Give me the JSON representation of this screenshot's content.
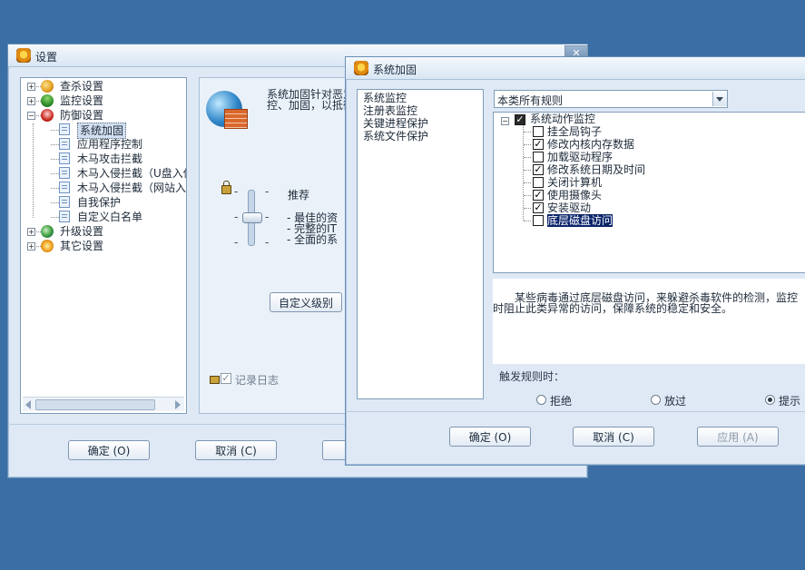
{
  "settings_window": {
    "title": "设置",
    "close_glyph": "✕",
    "tree": [
      {
        "label": "查杀设置",
        "expander": "+",
        "icon": "scan-icon"
      },
      {
        "label": "监控设置",
        "expander": "+",
        "icon": "umbrella-icon"
      },
      {
        "label": "防御设置",
        "expander": "−",
        "icon": "shield-icon"
      },
      {
        "label": "系统加固",
        "icon": "doc-icon",
        "selected": true
      },
      {
        "label": "应用程序控制",
        "icon": "doc-icon"
      },
      {
        "label": "木马攻击拦截",
        "icon": "doc-icon"
      },
      {
        "label": "木马入侵拦截（U盘入侵",
        "icon": "doc-icon"
      },
      {
        "label": "木马入侵拦截（网站入侵",
        "icon": "doc-icon"
      },
      {
        "label": "自我保护",
        "icon": "doc-icon"
      },
      {
        "label": "自定义白名单",
        "icon": "doc-icon"
      },
      {
        "label": "升级设置",
        "expander": "+",
        "icon": "globe-icon"
      },
      {
        "label": "其它设置",
        "expander": "+",
        "icon": "gear-icon"
      }
    ],
    "description": [
      "系统加固针对恶意",
      "控、加固，以抵御"
    ],
    "level_label": "推荐",
    "level_bullets": [
      "- 最佳的资",
      "- 完整的IT",
      "- 全面的系"
    ],
    "level_fraction": 0.5,
    "custom_level_button": "自定义级别",
    "log_checkbox": {
      "label": "记录日志",
      "checked": true
    },
    "ok_button": "确定 (O)",
    "cancel_button": "取消 (C)"
  },
  "harden_window": {
    "title": "系统加固",
    "categories": [
      "系统监控",
      "注册表监控",
      "关键进程保护",
      "系统文件保护"
    ],
    "rule_filter": "本类所有规则",
    "rule_root": {
      "label": "系统动作监控",
      "expander": "−",
      "checked": true
    },
    "rules": [
      {
        "label": "挂全局钩子",
        "checked": false
      },
      {
        "label": "修改内核内存数据",
        "checked": true
      },
      {
        "label": "加载驱动程序",
        "checked": false
      },
      {
        "label": "修改系统日期及时间",
        "checked": true
      },
      {
        "label": "关闭计算机",
        "checked": false
      },
      {
        "label": "使用摄像头",
        "checked": true
      },
      {
        "label": "安装驱动",
        "checked": true
      },
      {
        "label": "底层磁盘访问",
        "checked": false,
        "selected": true
      }
    ],
    "description": [
      "　　某些病毒通过底层磁盘访问，来躲避杀毒软件的检测，监控",
      "时阻止此类异常的访问，保障系统的稳定和安全。"
    ],
    "trigger_label": "触发规则时：",
    "actions": [
      {
        "label": "拒绝",
        "selected": false
      },
      {
        "label": "放过",
        "selected": false
      },
      {
        "label": "提示",
        "selected": true
      }
    ],
    "ok_button": "确定 (O)",
    "cancel_button": "取消 (C)",
    "apply_button": "应用 (A)"
  },
  "colors": {
    "desktop": "#3a6ea5",
    "selection": "#0a246a",
    "window_bg": "#dfe9f5"
  }
}
